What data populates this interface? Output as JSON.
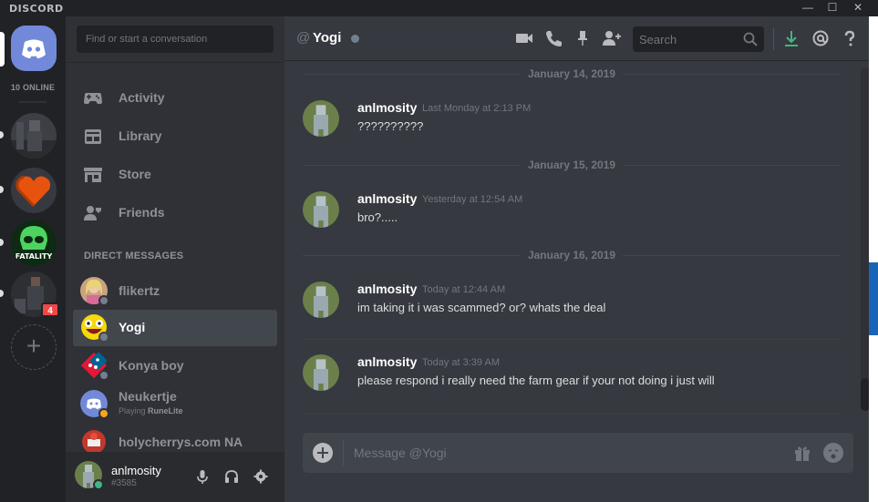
{
  "window": {
    "brand": "DISCORD",
    "minimize": "—",
    "maximize": "☐",
    "close": "✕"
  },
  "rail": {
    "online_label": "10 ONLINE",
    "mention_count": "4",
    "add_server": "+"
  },
  "sidebar": {
    "search_placeholder": "Find or start a conversation",
    "nav": [
      {
        "label": "Activity",
        "icon": "gamepad-icon"
      },
      {
        "label": "Library",
        "icon": "library-icon"
      },
      {
        "label": "Store",
        "icon": "store-icon"
      },
      {
        "label": "Friends",
        "icon": "friends-icon"
      }
    ],
    "dm_header": "DIRECT MESSAGES",
    "dms": [
      {
        "name": "flikertz",
        "status": "offline"
      },
      {
        "name": "Yogi",
        "status": "offline",
        "active": true
      },
      {
        "name": "Konya boy",
        "status": "offline"
      },
      {
        "name": "Neukertje",
        "status": "idle",
        "activity_prefix": "Playing ",
        "activity_game": "RuneLite"
      },
      {
        "name": "holycherrys.com NA",
        "status": "offline"
      }
    ]
  },
  "user": {
    "name": "anlmosity",
    "discriminator": "#3585",
    "status": "online"
  },
  "chat": {
    "header_at": "@",
    "channel_name": "Yogi",
    "search_placeholder": "Search",
    "composer_placeholder": "Message @Yogi",
    "day_separators": [
      "January 14, 2019",
      "January 15, 2019",
      "January 16, 2019"
    ],
    "messages": [
      {
        "author": "anlmosity",
        "time": "Last Monday at 2:13 PM",
        "content": "??????????"
      },
      {
        "author": "anlmosity",
        "time": "Yesterday at 12:54 AM",
        "content": "bro?....."
      },
      {
        "author": "anlmosity",
        "time": "Today at 12:44 AM",
        "content": "im taking it i was scammed? or? whats the deal"
      },
      {
        "author": "anlmosity",
        "time": "Today at 3:39 AM",
        "content": "please respond i really need the farm gear if your not doing i just will"
      }
    ]
  },
  "colors": {
    "blurple": "#7289da",
    "online": "#43b581",
    "idle": "#faa61a",
    "offline": "#747f8d",
    "mention": "#f04747"
  }
}
